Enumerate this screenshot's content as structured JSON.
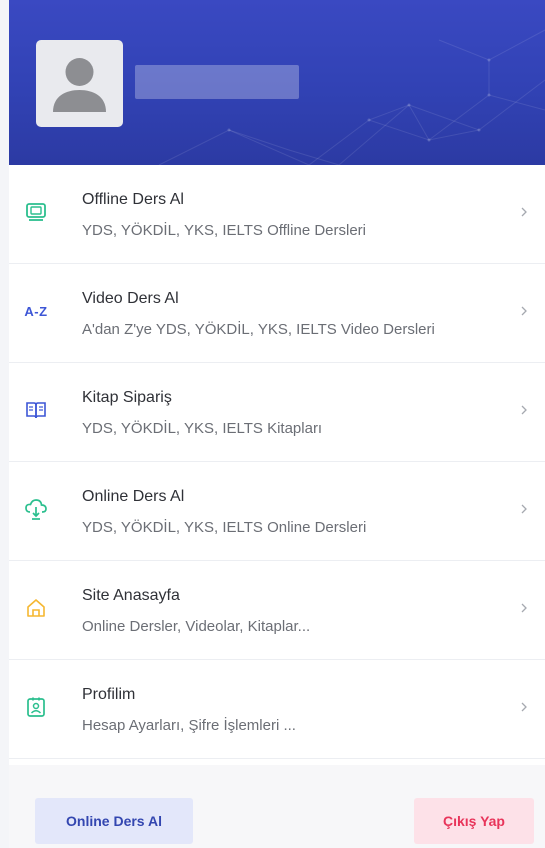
{
  "menu": [
    {
      "icon": "screen-icon",
      "title": "Offline Ders Al",
      "subtitle": "YDS, YÖKDİL, YKS, IELTS Offline Dersleri",
      "color": "#2bbf8e"
    },
    {
      "icon": "a-z-icon",
      "icon_text": "A-Z",
      "title": "Video Ders Al",
      "subtitle": "A'dan Z'ye YDS, YÖKDİL, YKS, IELTS Video Dersleri",
      "color": "#3d56d6"
    },
    {
      "icon": "book-icon",
      "title": "Kitap Sipariş",
      "subtitle": "YDS, YÖKDİL, YKS, IELTS Kitapları",
      "color": "#3d56d6"
    },
    {
      "icon": "cloud-download-icon",
      "title": "Online Ders Al",
      "subtitle": "YDS, YÖKDİL, YKS, IELTS Online Dersleri",
      "color": "#2bbf8e"
    },
    {
      "icon": "home-icon",
      "title": "Site Anasayfa",
      "subtitle": "Online Dersler, Videolar, Kitaplar...",
      "color": "#f5b731"
    },
    {
      "icon": "profile-card-icon",
      "title": "Profilim",
      "subtitle": "Hesap Ayarları, Şifre İşlemleri ...",
      "color": "#2bbf8e"
    }
  ],
  "footer": {
    "online_label": "Online Ders Al",
    "logout_label": "Çıkış Yap"
  },
  "colors": {
    "header": "#3445b8",
    "accent_blue": "#3346b0",
    "logout": "#e8345a"
  }
}
